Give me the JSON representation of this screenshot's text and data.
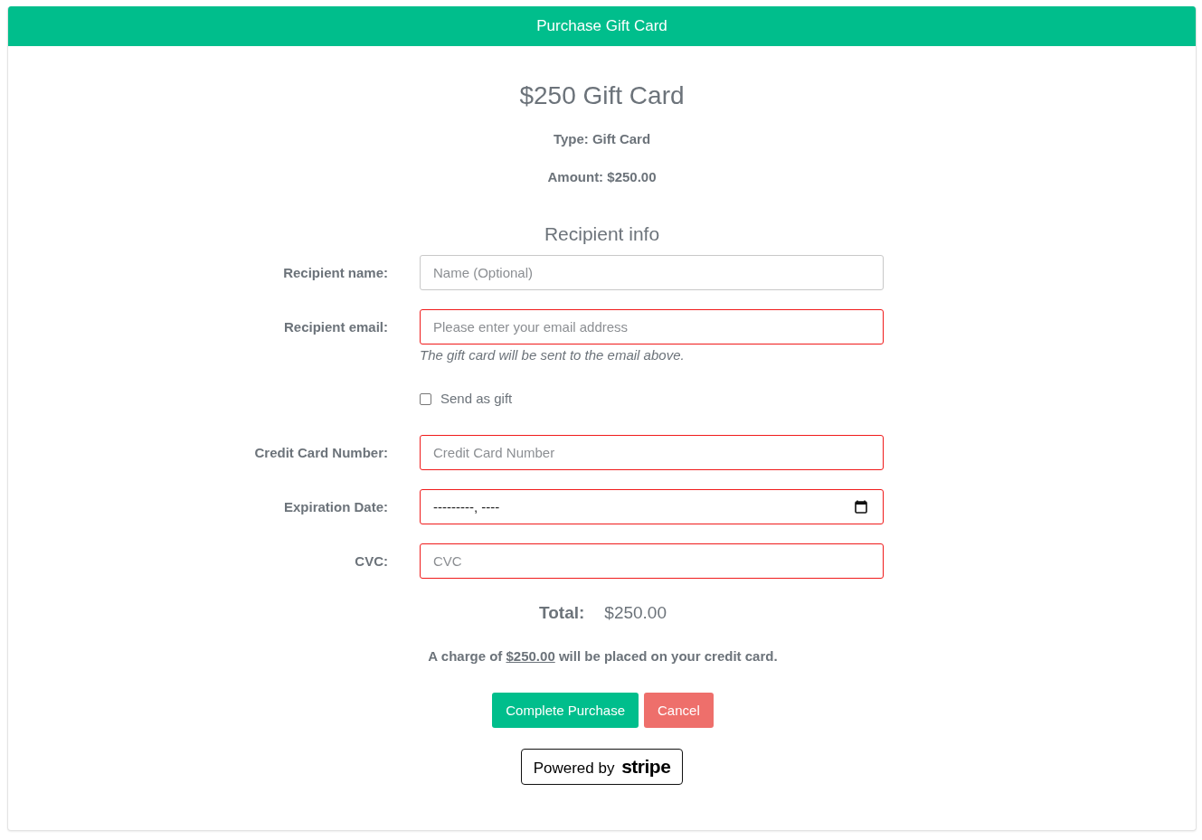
{
  "header": {
    "title": "Purchase Gift Card"
  },
  "product": {
    "title": "$250 Gift Card",
    "details": [
      "Type: Gift Card",
      "Amount: $250.00"
    ]
  },
  "recipient_heading": "Recipient info",
  "form_rows": [
    {
      "kind": "text",
      "label": "Recipient name:",
      "placeholder": "Name (Optional)",
      "invalid": false
    },
    {
      "kind": "text",
      "label": "Recipient email:",
      "placeholder": "Please enter your email address",
      "invalid": true,
      "help": "The gift card will be sent to the email above."
    },
    {
      "kind": "checkbox",
      "label": "Send as gift",
      "checked": false
    },
    {
      "kind": "text",
      "label": "Credit Card Number:",
      "placeholder": "Credit Card Number",
      "invalid": true
    },
    {
      "kind": "date",
      "label": "Expiration Date:",
      "placeholder": "---------, ----",
      "invalid": true
    },
    {
      "kind": "text",
      "label": "CVC:",
      "placeholder": "CVC",
      "invalid": true
    }
  ],
  "total": {
    "label": "Total:",
    "value": "$250.00"
  },
  "charge_notice": {
    "before": "A charge of",
    "link": "$250.00",
    "after": "will be placed on your credit card."
  },
  "buttons": [
    {
      "kind": "primary",
      "label": "Complete Purchase"
    },
    {
      "kind": "danger",
      "label": "Cancel"
    }
  ],
  "badge": {
    "text": "Powered by **stripe**"
  }
}
